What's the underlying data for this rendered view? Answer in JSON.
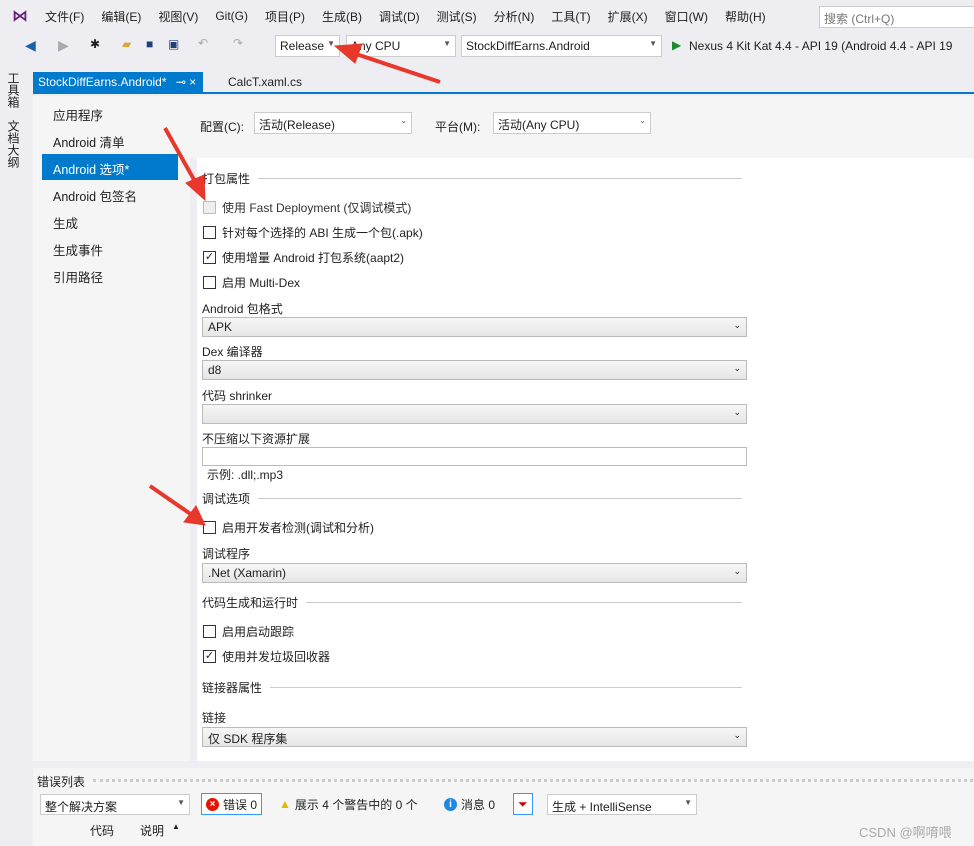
{
  "menu": {
    "items": [
      "文件(F)",
      "编辑(E)",
      "视图(V)",
      "Git(G)",
      "项目(P)",
      "生成(B)",
      "调试(D)",
      "测试(S)",
      "分析(N)",
      "工具(T)",
      "扩展(X)",
      "窗口(W)",
      "帮助(H)"
    ],
    "search_placeholder": "搜索 (Ctrl+Q)"
  },
  "toolbar": {
    "config": "Release",
    "platform": "Any CPU",
    "project": "StockDiffEarns.Android",
    "run_target": "Nexus 4 Kit Kat 4.4 - API 19 (Android 4.4 - API 19"
  },
  "tabs": [
    {
      "label": "StockDiffEarns.Android*"
    },
    {
      "label": "CalcT.xaml.cs"
    }
  ],
  "side_tools": [
    "工具箱",
    "文档大纲"
  ],
  "nav": [
    "应用程序",
    "Android 清单",
    "Android 选项*",
    "Android 包签名",
    "生成",
    "生成事件",
    "引用路径"
  ],
  "config": {
    "config_label": "配置(C):",
    "config_value": "活动(Release)",
    "platform_label": "平台(M):",
    "platform_value": "活动(Any CPU)"
  },
  "form": {
    "packaging_section": "打包属性",
    "cb_fast": "使用 Fast Deployment (仅调试模式)",
    "cb_abi": "针对每个选择的 ABI 生成一个包(.apk)",
    "cb_aapt2": "使用增量 Android 打包系统(aapt2)",
    "cb_multidex": "启用 Multi-Dex",
    "pkg_format_label": "Android 包格式",
    "pkg_format": "APK",
    "dex_label": "Dex 编译器",
    "dex": "d8",
    "shrinker_label": "代码 shrinker",
    "shrinker": "",
    "nocompress_label": "不压缩以下资源扩展",
    "nocompress_hint": "示例: .dll;.mp3",
    "debug_section": "调试选项",
    "cb_devinst": "启用开发者检测(调试和分析)",
    "debugger_label": "调试程序",
    "debugger": ".Net (Xamarin)",
    "codegen_section": "代码生成和运行时",
    "cb_trace": "启用启动跟踪",
    "cb_gc": "使用并发垃圾回收器",
    "linker_section": "链接器属性",
    "link_label": "链接",
    "link": "仅 SDK 程序集"
  },
  "errors": {
    "title": "错误列表",
    "scope": "整个解决方案",
    "errors": "错误 0",
    "warnings": "展示 4 个警告中的 0 个",
    "messages": "消息 0",
    "source": "生成 + IntelliSense",
    "col_code": "代码",
    "col_desc": "说明"
  },
  "watermark": "CSDN @啊唷喂"
}
